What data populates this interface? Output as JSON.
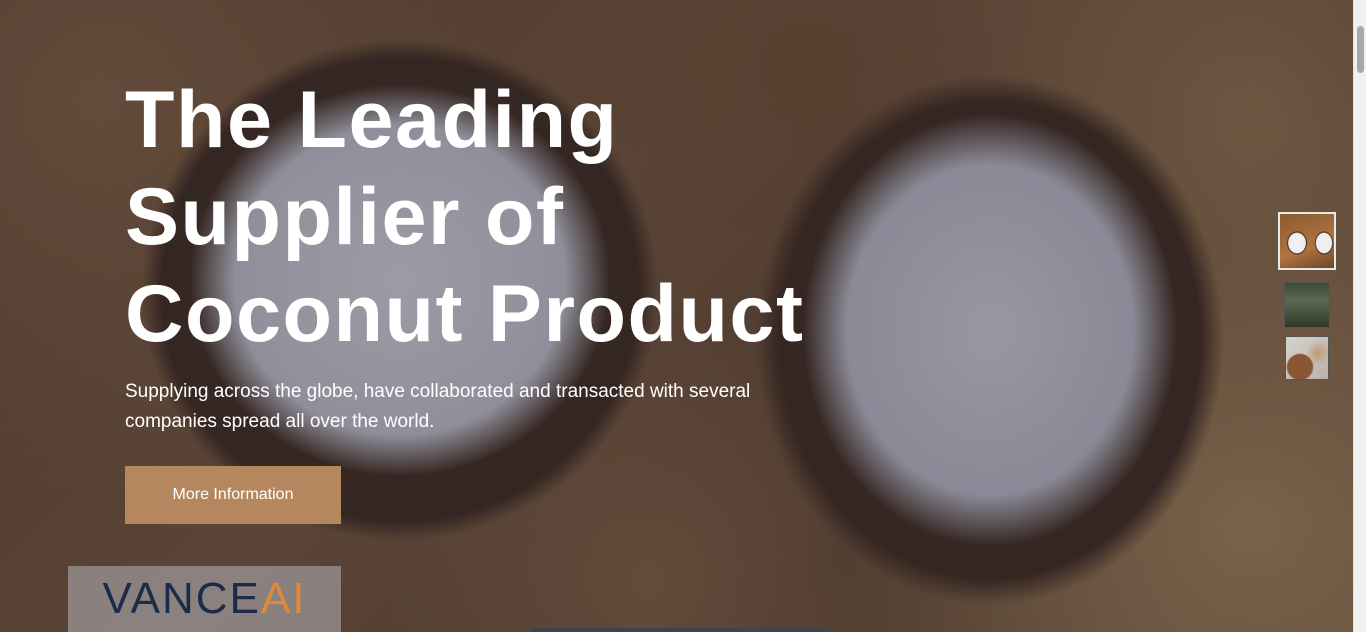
{
  "hero": {
    "headline_lines": [
      "The Leading",
      "Supplier of",
      "Coconut Product"
    ],
    "subtext": "Supplying across the globe, have collaborated and transacted with several companies spread all over the world.",
    "cta_label": "More Information",
    "background_image": "split-coconut-halves"
  },
  "watermark": {
    "text_main": "VANCE",
    "text_accent": "AI",
    "color_main": "#1c2c48",
    "color_accent": "#e0893a"
  },
  "thumbnails": {
    "items": [
      {
        "label": "coconut-halves-thumbnail",
        "active": true
      },
      {
        "label": "palm-forest-thumbnail",
        "active": false
      },
      {
        "label": "coconut-products-thumbnail",
        "active": false
      }
    ]
  },
  "colors": {
    "cta_background": "#b5875e",
    "headline": "#ffffff",
    "overlay": "rgba(40,40,60,0.28)"
  }
}
